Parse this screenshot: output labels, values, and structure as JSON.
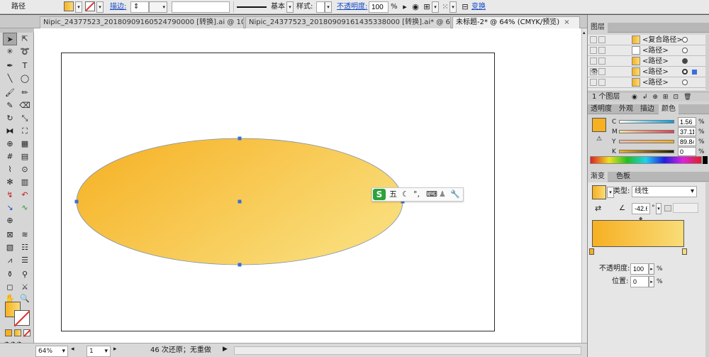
{
  "control_bar": {
    "selection_label": "路径",
    "stroke_link": "描边:",
    "stroke_profile": "基本",
    "style_label": "样式:",
    "opacity_link": "不透明度:",
    "opacity_value": "100",
    "opacity_unit": "%",
    "transform_link": "变换"
  },
  "tabs": [
    {
      "label": "Nipic_24377523_20180909160524790000 [转换].ai @ 10..."
    },
    {
      "label": "Nipic_24377523_20180909161435338000 [转换].ai* @ 6..."
    },
    {
      "label": "未标题-2* @ 64% (CMYK/预览)"
    }
  ],
  "status_bar": {
    "zoom": "64%",
    "page": "1",
    "history": "46 次还原；无重做"
  },
  "layers_panel": {
    "title": "图层",
    "rows": [
      {
        "name": "<复合路径>"
      },
      {
        "name": "<路径>"
      },
      {
        "name": "<路径>"
      },
      {
        "name": "<路径>"
      },
      {
        "name": "<路径>"
      }
    ],
    "footer": "1 个图层"
  },
  "color_panel": {
    "tabs": [
      "透明度",
      "外观",
      "描边",
      "颜色"
    ],
    "channels": [
      {
        "label": "C",
        "value": "1.56",
        "unit": "%"
      },
      {
        "label": "M",
        "value": "37.11",
        "unit": "%"
      },
      {
        "label": "Y",
        "value": "89.84",
        "unit": "%"
      },
      {
        "label": "K",
        "value": "0",
        "unit": "%"
      }
    ]
  },
  "gradient_panel": {
    "tabs": [
      "渐变",
      "色板"
    ],
    "type_label": "类型:",
    "type_value": "线性",
    "angle": "-42.6",
    "angle_unit": "°",
    "opacity_label": "不透明度:",
    "opacity_value": "100",
    "opacity_unit": "%",
    "location_label": "位置:",
    "location_value": "0",
    "location_unit": "%",
    "start_color": "#f6b022",
    "end_color": "#f9dc78"
  },
  "ime_bar": {
    "logo": "S",
    "mode": "五"
  },
  "colors": {
    "ellipse_stroke": "#7b8fb0",
    "anchor": "#3b6fd8",
    "gradient_start": "#f6b022",
    "gradient_end": "#f9dc78"
  }
}
